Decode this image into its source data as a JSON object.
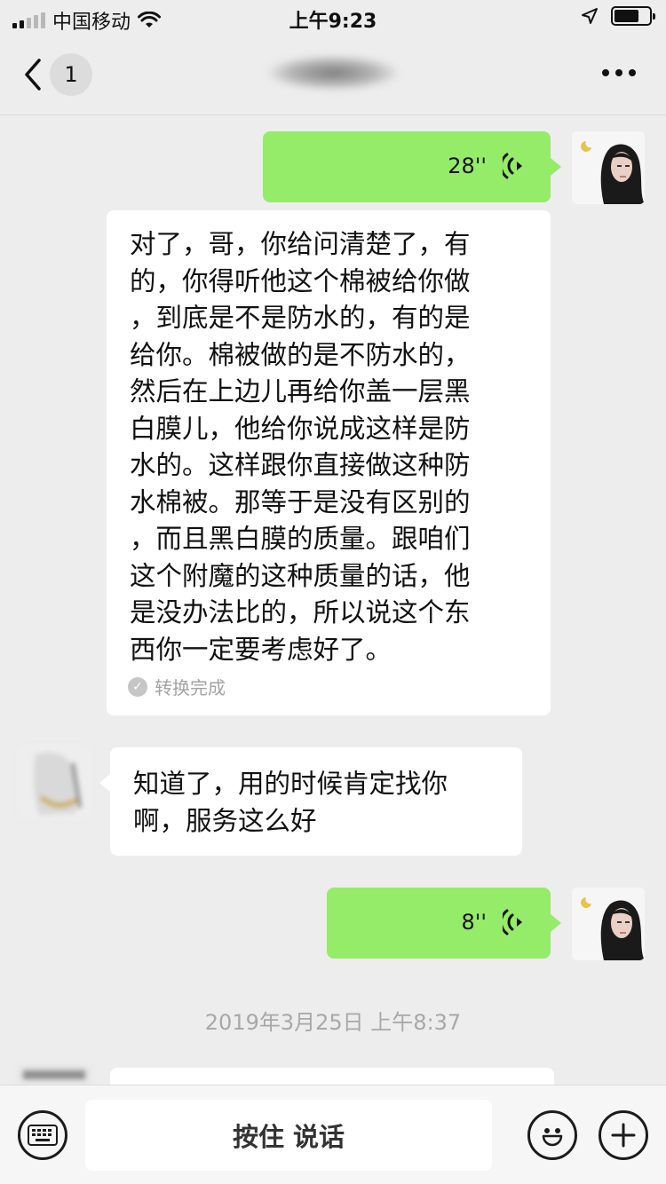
{
  "status_bar": {
    "carrier": "中国移动",
    "time": "上午9:23",
    "icons": [
      "signal-icon",
      "wifi-icon",
      "location-arrow-icon",
      "battery-icon"
    ]
  },
  "nav": {
    "back_icon": "chevron-left-icon",
    "unread_count": "1",
    "contact_name": "",
    "more_icon": "more-dots-icon"
  },
  "messages": [
    {
      "type": "voice",
      "side": "right",
      "duration": "28''"
    },
    {
      "type": "transcript",
      "side": "right",
      "text": "对了，哥，你给问清楚了，有\n的，你得听他这个棉被给你做\n，到底是不是防水的，有的是\n给你。棉被做的是不防水的，\n然后在上边儿再给你盖一层黑\n白膜儿，他给你说成这样是防\n水的。这样跟你直接做这种防\n水棉被。那等于是没有区别的\n，而且黑白膜的质量。跟咱们\n这个附魔的这种质量的话，他\n是没办法比的，所以说这个东\n西你一定要考虑好了。",
      "status": "转换完成"
    },
    {
      "type": "text",
      "side": "left",
      "text": "知道了，用的时候肯定找你\n啊，服务这么好"
    },
    {
      "type": "voice",
      "side": "right",
      "duration": "8''"
    },
    {
      "type": "timestamp",
      "text": "2019年3月25日 上午8:37"
    }
  ],
  "input_bar": {
    "keyboard_icon": "keyboard-icon",
    "hold_to_talk": "按住 说话",
    "emoji_icon": "emoji-icon",
    "plus_icon": "plus-icon"
  },
  "colors": {
    "background": "#ededed",
    "bubble_self": "#95ec69",
    "bubble_other": "#ffffff",
    "muted_text": "#a8a8a8"
  }
}
